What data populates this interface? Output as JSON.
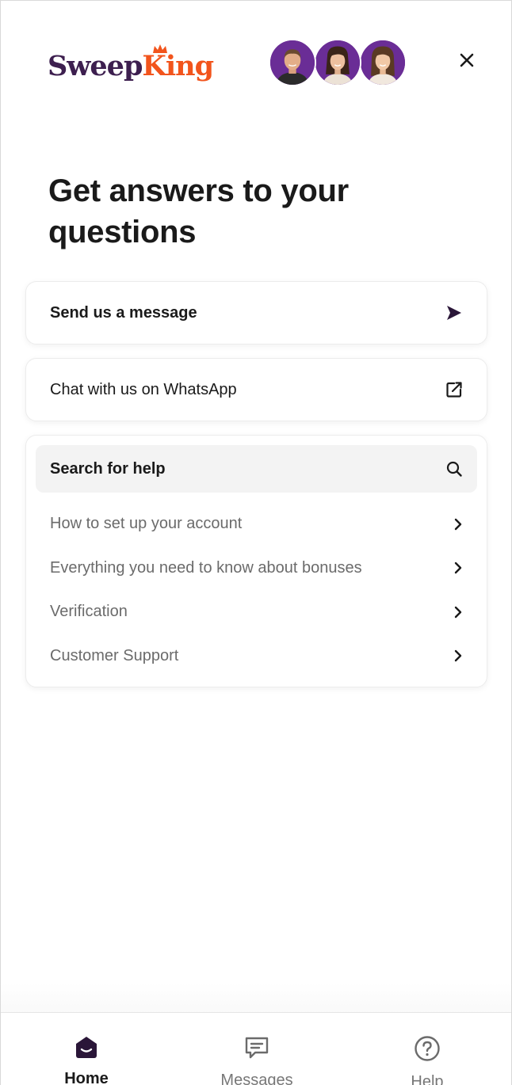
{
  "brand": {
    "name_part1": "Sweep",
    "name_part2": "King",
    "color_primary": "#3d1f4f",
    "color_accent": "#f2541c"
  },
  "header": {
    "avatars": [
      {
        "name": "avatar-1"
      },
      {
        "name": "avatar-2"
      },
      {
        "name": "avatar-3"
      }
    ],
    "close_icon": "close-icon"
  },
  "main": {
    "headline": "Get answers to your questions",
    "send_message": {
      "label": "Send us a message",
      "icon": "send-arrow-icon"
    },
    "whatsapp": {
      "label": "Chat with us on WhatsApp",
      "icon": "external-link-icon"
    },
    "search": {
      "label": "Search for help",
      "icon": "search-icon"
    },
    "help_items": [
      {
        "label": "How to set up your account"
      },
      {
        "label": "Everything you need to know about bonuses"
      },
      {
        "label": "Verification"
      },
      {
        "label": "Customer Support"
      }
    ]
  },
  "bottom_nav": {
    "items": [
      {
        "label": "Home",
        "icon": "home-icon",
        "active": true
      },
      {
        "label": "Messages",
        "icon": "messages-icon",
        "active": false
      },
      {
        "label": "Help",
        "icon": "help-icon",
        "active": false
      }
    ]
  }
}
